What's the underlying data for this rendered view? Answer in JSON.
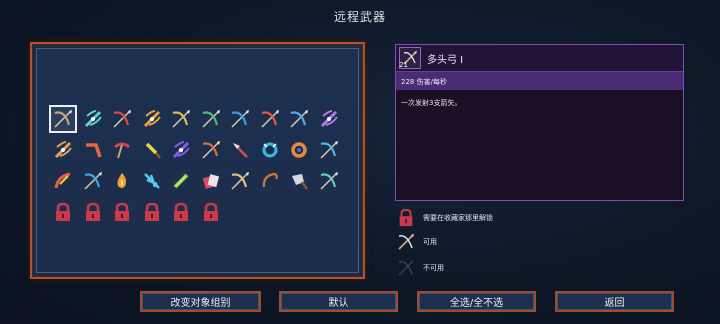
{
  "screen_title": "远程武器",
  "weapons": [
    {
      "icon": "bow-icon",
      "color": "#c9a47a",
      "selected": true
    },
    {
      "icon": "crossbow-icon",
      "color": "#5fd0c8"
    },
    {
      "icon": "bow-icon",
      "color": "#e04b3a"
    },
    {
      "icon": "crossbow-icon",
      "color": "#e8a23a"
    },
    {
      "icon": "bow-icon",
      "color": "#e6b84a"
    },
    {
      "icon": "bow-icon",
      "color": "#49c07a"
    },
    {
      "icon": "bow-icon",
      "color": "#3a9fe6"
    },
    {
      "icon": "bow-icon",
      "color": "#e8564a"
    },
    {
      "icon": "bow-icon",
      "color": "#4ab0e6"
    },
    {
      "icon": "crossbow-icon",
      "color": "#b07ae6"
    },
    {
      "icon": "crossbow-icon",
      "color": "#e0a060"
    },
    {
      "icon": "boomerang-icon",
      "color": "#e06a3a"
    },
    {
      "icon": "pickaxe-icon",
      "color": "#d04a4a"
    },
    {
      "icon": "dagger-icon",
      "color": "#e8d24a"
    },
    {
      "icon": "crossbow-icon",
      "color": "#8a5ae6"
    },
    {
      "icon": "bow-icon",
      "color": "#e0703a"
    },
    {
      "icon": "spear-icon",
      "color": "#e04a4a"
    },
    {
      "icon": "chakram-icon",
      "color": "#3ab8e6"
    },
    {
      "icon": "ring-icon",
      "color": "#e8883a"
    },
    {
      "icon": "bow-icon",
      "color": "#4ab8e6"
    },
    {
      "icon": "flame-bow-icon",
      "color": "#e8603a"
    },
    {
      "icon": "bow-icon",
      "color": "#3aa8e6"
    },
    {
      "icon": "fire-icon",
      "color": "#f0a030"
    },
    {
      "icon": "ice-crystal-icon",
      "color": "#5ac8f0"
    },
    {
      "icon": "staff-icon",
      "color": "#8ad04a"
    },
    {
      "icon": "cards-icon",
      "color": "#e04a6a"
    },
    {
      "icon": "bow-icon",
      "color": "#e0c07a"
    },
    {
      "icon": "whip-icon",
      "color": "#d07a3a"
    },
    {
      "icon": "cleaver-icon",
      "color": "#d8d8e0"
    },
    {
      "icon": "bow-icon",
      "color": "#5ad0c0"
    },
    {
      "icon": "lock-icon",
      "color": "#c93a4a"
    },
    {
      "icon": "lock-icon",
      "color": "#c93a4a"
    },
    {
      "icon": "lock-icon",
      "color": "#c93a4a"
    },
    {
      "icon": "lock-icon",
      "color": "#c93a4a"
    },
    {
      "icon": "lock-icon",
      "color": "#c93a4a"
    },
    {
      "icon": "lock-icon",
      "color": "#c93a4a"
    }
  ],
  "detail": {
    "level": "21",
    "name": "多头弓 I",
    "stat": "228 伤害/每秒",
    "description": "一次发射3支箭矢。"
  },
  "legend": {
    "locked": "需要在收藏家那里解锁",
    "available": "可用",
    "unavailable": "不可用"
  },
  "buttons": {
    "change_group": "改变对象组别",
    "default": "默认",
    "select_all": "全选/全不选",
    "back": "返回"
  },
  "colors": {
    "panel_border": "#b8502a",
    "detail_border": "#7d4fb3",
    "stat_bar": "#4b2b74",
    "lock": "#c93a4a"
  }
}
